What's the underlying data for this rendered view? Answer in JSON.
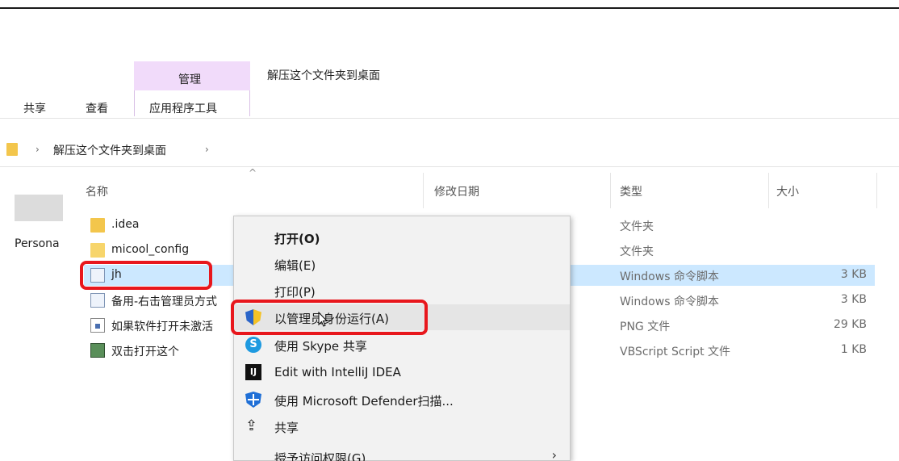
{
  "ribbon": {
    "manage_label": "管理",
    "contextual_title": "解压这个文件夹到桌面",
    "tabs": [
      "共享",
      "查看",
      "应用程序工具"
    ]
  },
  "address": {
    "path": "解压这个文件夹到桌面",
    "separator": "›"
  },
  "nav": {
    "item_label": "Persona"
  },
  "columns": {
    "name": "名称",
    "modified": "修改日期",
    "type": "类型",
    "size": "大小"
  },
  "files": [
    {
      "name": ".idea",
      "type": "文件夹",
      "size": "",
      "icon": "folder-icon"
    },
    {
      "name": "micool_config",
      "type": "文件夹",
      "size": "",
      "icon": "folder-icon"
    },
    {
      "name": "jh",
      "type": "Windows 命令脚本",
      "size": "3 KB",
      "icon": "cmd-file-icon"
    },
    {
      "name": "备用-右击管理员方式",
      "type": "Windows 命令脚本",
      "size": "3 KB",
      "icon": "cmd-file-icon"
    },
    {
      "name": "如果软件打开未激活",
      "type": "PNG 文件",
      "size": "29 KB",
      "icon": "png-file-icon"
    },
    {
      "name": "双击打开这个",
      "type": "VBScript Script 文件",
      "size": "1 KB",
      "icon": "vbs-file-icon"
    }
  ],
  "context_menu": {
    "items": [
      {
        "label": "打开(O)",
        "icon": ""
      },
      {
        "label": "编辑(E)",
        "icon": ""
      },
      {
        "label": "打印(P)",
        "icon": ""
      },
      {
        "label": "以管理员身份运行(A)",
        "icon": "uac-shield-icon"
      },
      {
        "label": "使用 Skype 共享",
        "icon": "skype-icon"
      },
      {
        "label": "Edit with IntelliJ IDEA",
        "icon": "intellij-icon"
      },
      {
        "label": "使用 Microsoft Defender扫描...",
        "icon": "defender-icon"
      },
      {
        "label": "共享",
        "icon": "share-icon"
      },
      {
        "label": "授予访问权限(G)",
        "icon": ""
      }
    ]
  },
  "colors": {
    "selection": "#cce8ff",
    "manage_tab": "#f1dbfa",
    "highlight": "#e8171d"
  }
}
